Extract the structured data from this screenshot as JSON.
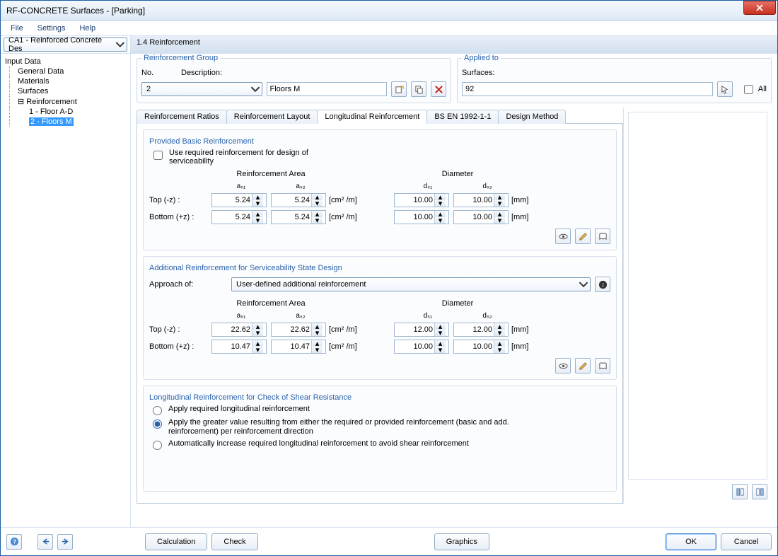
{
  "window": {
    "title": "RF-CONCRETE Surfaces - [Parking]"
  },
  "menu": {
    "file": "File",
    "settings": "Settings",
    "help": "Help"
  },
  "case_selector": "CA1 - Reinforced Concrete Des",
  "section_header": "1.4 Reinforcement",
  "tree": {
    "input_data": "Input Data",
    "general": "General Data",
    "materials": "Materials",
    "surfaces": "Surfaces",
    "reinforcement": "Reinforcement",
    "r1": "1 - Floor A-D",
    "r2": "2 - Floors M"
  },
  "group": {
    "legend": "Reinforcement Group",
    "no_lbl": "No.",
    "no_val": "2",
    "desc_lbl": "Description:",
    "desc_val": "Floors M"
  },
  "applied": {
    "legend": "Applied to",
    "surfaces_lbl": "Surfaces:",
    "surfaces_val": "92",
    "all": "All"
  },
  "tabs": {
    "t1": "Reinforcement Ratios",
    "t2": "Reinforcement Layout",
    "t3": "Longitudinal Reinforcement",
    "t4": "BS EN 1992-1-1",
    "t5": "Design Method"
  },
  "panel1": {
    "legend": "Provided Basic Reinforcement",
    "use_required": "Use required reinforcement for design of serviceability",
    "area_hdr": "Reinforcement Area",
    "dia_hdr": "Diameter",
    "as1": "aₛ₁",
    "as2": "aₛ₂",
    "ds1": "dₛ₁",
    "ds2": "dₛ₂",
    "top_lbl": "Top (-z) :",
    "bot_lbl": "Bottom (+z) :",
    "unit_area": "[cm² /m]",
    "unit_dia": "[mm]",
    "top_as1": "5.24",
    "top_as2": "5.24",
    "top_ds1": "10.00",
    "top_ds2": "10.00",
    "bot_as1": "5.24",
    "bot_as2": "5.24",
    "bot_ds1": "10.00",
    "bot_ds2": "10.00"
  },
  "panel2": {
    "legend": "Additional Reinforcement for Serviceability State Design",
    "approach_lbl": "Approach of:",
    "approach_val": "User-defined additional reinforcement",
    "top_as1": "22.62",
    "top_as2": "22.62",
    "top_ds1": "12.00",
    "top_ds2": "12.00",
    "bot_as1": "10.47",
    "bot_as2": "10.47",
    "bot_ds1": "10.00",
    "bot_ds2": "10.00"
  },
  "panel3": {
    "legend": "Longitudinal Reinforcement for Check of Shear Resistance",
    "opt1": "Apply required longitudinal reinforcement",
    "opt2": "Apply the greater value resulting from either the required or provided reinforcement (basic and add. reinforcement) per reinforcement direction",
    "opt3": "Automatically increase required longitudinal reinforcement to avoid shear reinforcement"
  },
  "buttons": {
    "calculation": "Calculation",
    "check": "Check",
    "graphics": "Graphics",
    "ok": "OK",
    "cancel": "Cancel"
  },
  "icons": {
    "close": "close-icon",
    "help": "help-icon",
    "prev": "prev-icon",
    "next": "next-icon",
    "new": "new-icon",
    "copy": "copy-icon",
    "delete": "delete-icon",
    "pick": "pick-icon",
    "eye": "eye-icon",
    "edit": "edit-icon",
    "lib": "library-icon",
    "info": "info-icon",
    "cfg1": "config1-icon",
    "cfg2": "config2-icon"
  }
}
